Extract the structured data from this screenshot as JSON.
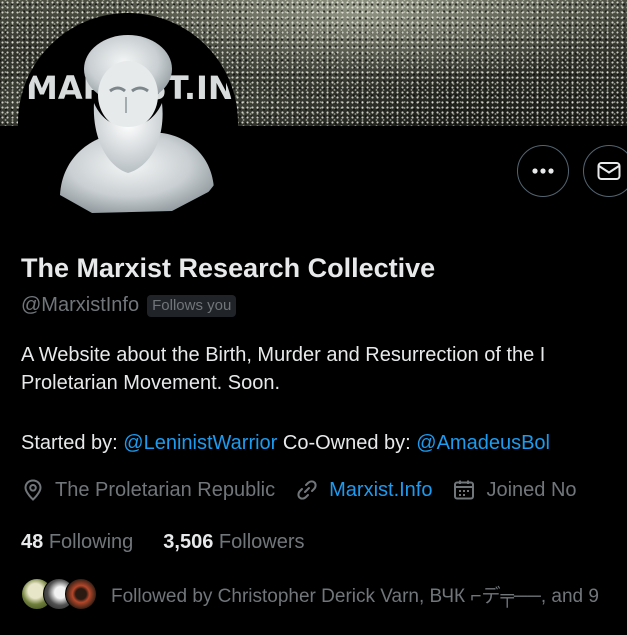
{
  "banner": {
    "alt": "banner"
  },
  "avatar": {
    "text": "MARXIST.INFO"
  },
  "actions": {
    "more_icon": "more-dots-icon",
    "message_icon": "envelope-icon"
  },
  "profile": {
    "name": "The Marxist Research Collective",
    "handle": "@MarxistInfo",
    "follows_you": "Follows you"
  },
  "bio": {
    "line1": "A Website about the Birth, Murder and Resurrection of the I",
    "line2": "Proletarian Movement. Soon.",
    "started_by_label": "Started by: ",
    "started_by_link": "@LeninistWarrior",
    "co_owned_label": " Co-Owned by: ",
    "co_owned_link": "@AmadeusBol"
  },
  "meta": {
    "location": "The Proletarian Republic",
    "website": "Marxist.Info",
    "joined": "Joined No"
  },
  "stats": {
    "following_count": "48",
    "following_label": "Following",
    "followers_count": "3,506",
    "followers_label": "Followers"
  },
  "followed_by": {
    "text": "Followed by Christopher Derick Varn, ВЧК ⌐デ╤──, and 9"
  },
  "colors": {
    "background": "#000000",
    "text": "#e7e9ea",
    "secondary": "#71767b",
    "link": "#1d9bf0",
    "border": "#536471"
  }
}
